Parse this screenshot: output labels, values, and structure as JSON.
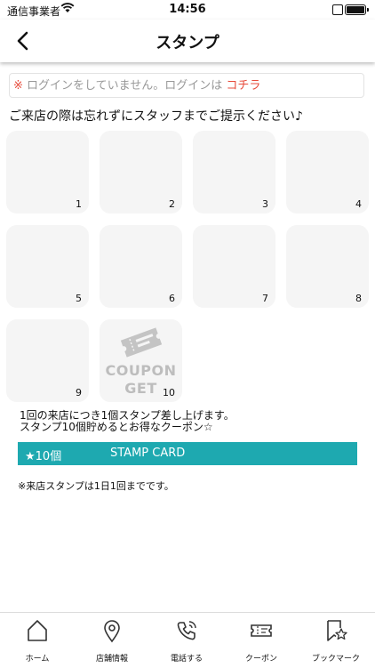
{
  "status_bar": {
    "carrier": "通信事業者",
    "time": "14:56"
  },
  "header": {
    "title": "スタンプ",
    "back_icon": "chevron-left-icon"
  },
  "login_notice": {
    "mark": "※",
    "message": " ログインをしていません。ログインは ",
    "link": "コチラ"
  },
  "instruction": "ご来店の際は忘れずにスタッフまでご提示ください♪",
  "stamps": {
    "s1": "1",
    "s2": "2",
    "s3": "3",
    "s4": "4",
    "s5": "5",
    "s6": "6",
    "s7": "7",
    "s8": "8",
    "s9": "9",
    "s10": "10",
    "coupon_line1": "COUPON",
    "coupon_line2": "GET"
  },
  "note": {
    "line1": "1回の来店につき1個スタンプ差し上げます。",
    "line2": "スタンプ10個貯めるとお得なクーポン☆"
  },
  "stamp_card": {
    "count": "★10個",
    "label": "STAMP CARD",
    "color": "#1ea9b0"
  },
  "limit_note": "※来店スタンプは1日1回までです。",
  "tabs": {
    "home": "ホーム",
    "store": "店舗情報",
    "call": "電話する",
    "coupon": "クーポン",
    "bookmark": "ブックマーク"
  }
}
